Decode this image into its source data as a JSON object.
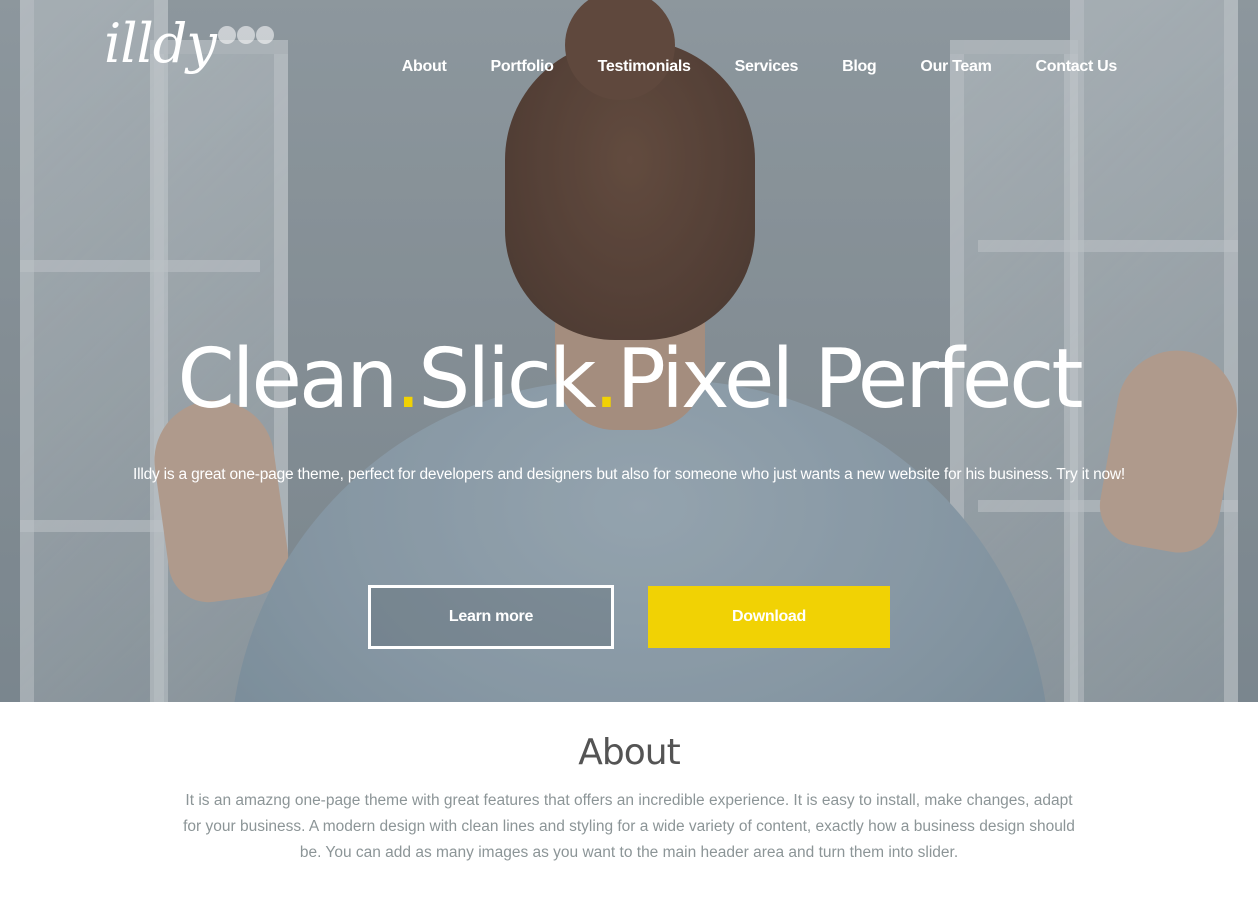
{
  "logo": {
    "text": "illdy"
  },
  "nav": {
    "items": [
      {
        "label": "About"
      },
      {
        "label": "Portfolio"
      },
      {
        "label": "Testimonials"
      },
      {
        "label": "Services"
      },
      {
        "label": "Blog"
      },
      {
        "label": "Our Team"
      },
      {
        "label": "Contact Us"
      }
    ]
  },
  "hero": {
    "title_parts": [
      "Clean",
      ".",
      "Slick",
      ".",
      "Pixel Perfect"
    ],
    "subtitle": "Illdy is a great one-page theme, perfect for developers and designers but also for someone who just wants a new website for his business. Try it now!",
    "learn_more_label": "Learn more",
    "download_label": "Download"
  },
  "about": {
    "title": "About",
    "text": "It is an amazng one-page theme with great features that offers an incredible experience. It is easy to install, make changes, adapt for your business. A modern design with clean lines and styling for a wide variety of content, exactly how a business design should be. You can add as many images as you want to the main header area and turn them into slider."
  },
  "colors": {
    "accent": "#f1d204",
    "heading": "#545454",
    "body_text": "#8c9597"
  }
}
